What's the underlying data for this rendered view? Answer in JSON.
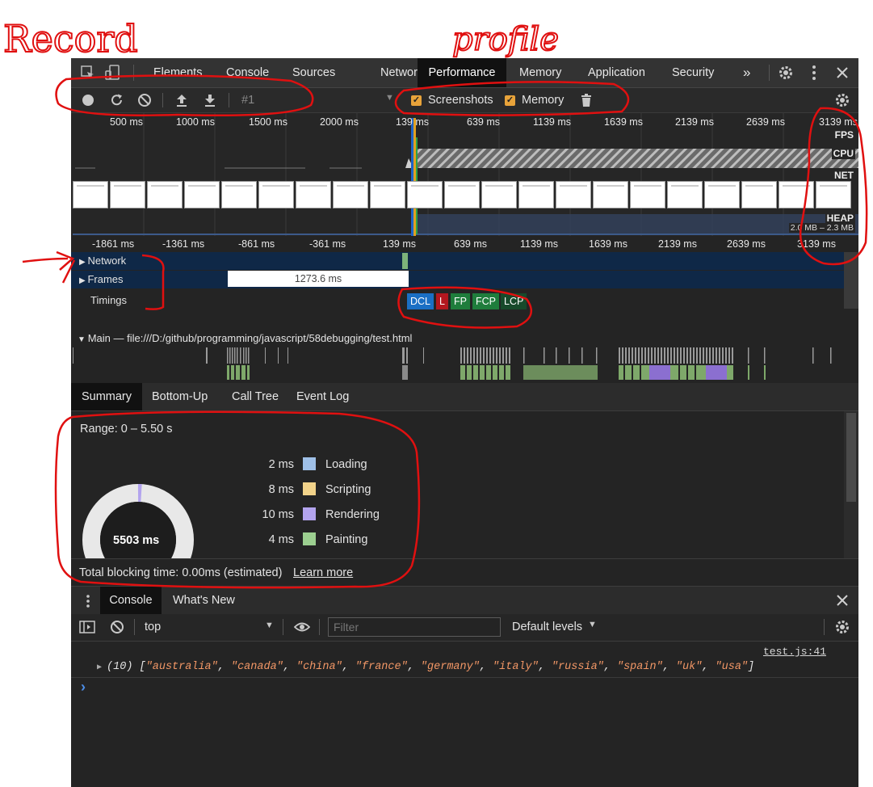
{
  "annotations": {
    "record": "Record",
    "profile": "profile"
  },
  "tabbar": {
    "tabs": [
      "Elements",
      "Console",
      "Sources",
      "Network",
      "Performance",
      "Memory",
      "Application",
      "Security"
    ],
    "active": "Performance",
    "more": "»"
  },
  "perf_toolbar": {
    "profile_select": "#1",
    "screenshots_label": "Screenshots",
    "screenshots_checked": true,
    "memory_label": "Memory",
    "memory_checked": true
  },
  "overview": {
    "ruler": [
      "500 ms",
      "1000 ms",
      "1500 ms",
      "2000 ms",
      "139 ms",
      "639 ms",
      "1139 ms",
      "1639 ms",
      "2139 ms",
      "2639 ms",
      "3139 ms"
    ],
    "labels": {
      "fps": "FPS",
      "cpu": "CPU",
      "net": "NET",
      "heap": "HEAP"
    },
    "heap_range": "2.0 MB – 2.3 MB"
  },
  "timeline": {
    "ruler": [
      "-1861 ms",
      "-1361 ms",
      "-861 ms",
      "-361 ms",
      "139 ms",
      "639 ms",
      "1139 ms",
      "1639 ms",
      "2139 ms",
      "2639 ms",
      "3139 ms"
    ],
    "network": "Network",
    "frames": "Frames",
    "frame_tooltip": "1273.6 ms",
    "timings": "Timings",
    "markers": [
      {
        "label": "DCL",
        "color": "#1a6fc4"
      },
      {
        "label": "L",
        "color": "#b3171f"
      },
      {
        "label": "FP",
        "color": "#1f7d3c"
      },
      {
        "label": "FCP",
        "color": "#1f7d3c"
      },
      {
        "label": "LCP",
        "color": "#174a2b"
      }
    ],
    "main": "Main — file:///D:/github/programming/javascript/58debugging/test.html"
  },
  "bottom_tabs": [
    "Summary",
    "Bottom-Up",
    "Call Tree",
    "Event Log"
  ],
  "summary": {
    "range": "Range: 0 – 5.50 s",
    "total": "5503 ms",
    "rows": [
      {
        "value": "2 ms",
        "label": "Loading",
        "color": "#9fc0e8"
      },
      {
        "value": "8 ms",
        "label": "Scripting",
        "color": "#f2d38a"
      },
      {
        "value": "10 ms",
        "label": "Rendering",
        "color": "#b3a4ee"
      },
      {
        "value": "4 ms",
        "label": "Painting",
        "color": "#9ccf90"
      }
    ],
    "blocking": "Total blocking time: 0.00ms (estimated)",
    "learn_more": "Learn more"
  },
  "drawer": {
    "tabs": [
      "Console",
      "What's New"
    ],
    "context": "top",
    "filter_placeholder": "Filter",
    "levels": "Default levels",
    "log_source": "test.js:41",
    "log_count": "(10)",
    "log_items": [
      "\"australia\"",
      "\"canada\"",
      "\"china\"",
      "\"france\"",
      "\"germany\"",
      "\"italy\"",
      "\"russia\"",
      "\"spain\"",
      "\"uk\"",
      "\"usa\""
    ],
    "prompt": "›"
  }
}
